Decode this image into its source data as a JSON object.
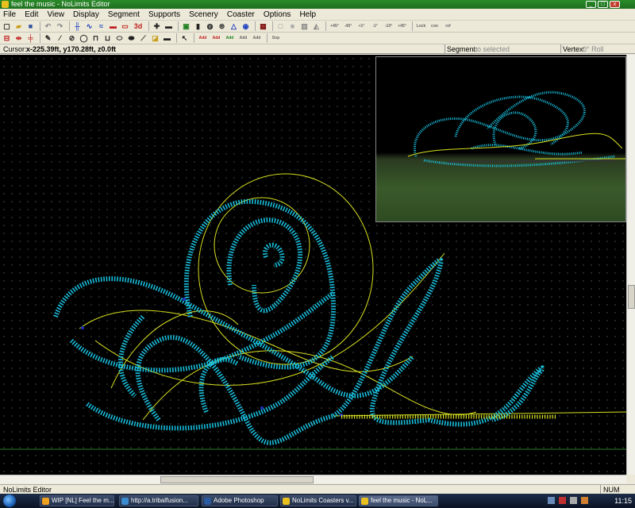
{
  "window": {
    "title": "feel the music - NoLimits Editor"
  },
  "menu": [
    "File",
    "Edit",
    "View",
    "Display",
    "Segment",
    "Supports",
    "Scenery",
    "Coaster",
    "Options",
    "Help"
  ],
  "toolbar2_labels": {
    "lock": "Lock",
    "con": "con",
    "ref": "ref",
    "roll": "Roll",
    "snp": "Snp",
    "add": "Add",
    "d3": "3d"
  },
  "rotation_labels": [
    "+45°",
    "-45°",
    "+1°",
    "-1°",
    "-10°",
    "+45°"
  ],
  "status": {
    "cursor_label": "Cursor:",
    "cursor_value": "x-225.39ft, y170.28ft, z0.0ft",
    "segment_label": "Segment:",
    "segment_value": "no selected",
    "vertex_label": "Vertex:",
    "vertex_value": "0° Roll"
  },
  "statusbar": {
    "app": "NoLimits Editor",
    "num": "NUM"
  },
  "taskbar": {
    "items": [
      {
        "label": "WIP [NL] Feel the m..."
      },
      {
        "label": "http://a.tribalfusion..."
      },
      {
        "label": "Adobe Photoshop"
      },
      {
        "label": "NoLimits Coasters v..."
      },
      {
        "label": "feel the music - NoL..."
      }
    ],
    "clock": "11:15",
    "tray_icons": [
      "network-icon",
      "volume-icon",
      "security-icon",
      "speaker-icon"
    ]
  },
  "colors": {
    "track": "#19c8e8",
    "spline": "#d8e020",
    "grid": "#3a4a3a",
    "titlebar": "#2a8a2a"
  }
}
